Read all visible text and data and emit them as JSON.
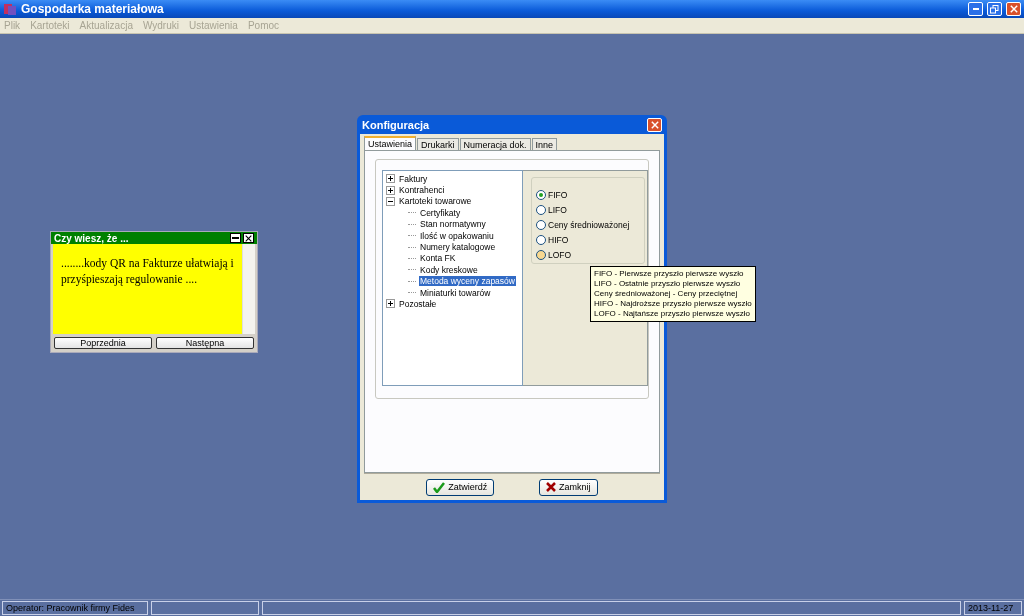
{
  "window": {
    "title": "Gospodarka materiałowa"
  },
  "menu": [
    {
      "label": "Plik",
      "disabled": true
    },
    {
      "label": "Kartoteki",
      "disabled": true
    },
    {
      "label": "Aktualizacja",
      "disabled": true
    },
    {
      "label": "Wydruki",
      "disabled": true
    },
    {
      "label": "Ustawienia",
      "disabled": true
    },
    {
      "label": "Pomoc",
      "disabled": true
    }
  ],
  "tip_window": {
    "title": "Czy wiesz, że ...",
    "message": "........kody QR na Fakturze ułatwiają i przyśpieszają regulowanie ....",
    "buttons": [
      "Poprzednia",
      "Następna"
    ]
  },
  "dialog": {
    "title": "Konfiguracja",
    "tabs": [
      {
        "label": "Ustawienia",
        "selected": true
      },
      {
        "label": "Drukarki",
        "selected": false
      },
      {
        "label": "Numeracja dok.",
        "selected": false
      },
      {
        "label": "Inne",
        "selected": false
      }
    ],
    "tree": [
      {
        "label": "Faktury",
        "expanded": false,
        "selected": false
      },
      {
        "label": "Kontrahenci",
        "expanded": false,
        "selected": false
      },
      {
        "label": "Kartoteki towarowe",
        "expanded": true,
        "selected": false,
        "children": [
          {
            "label": "Certyfikaty",
            "selected": false
          },
          {
            "label": "Stan normatywny",
            "selected": false
          },
          {
            "label": "Ilość w opakowaniu",
            "selected": false
          },
          {
            "label": "Numery katalogowe",
            "selected": false
          },
          {
            "label": "Konta FK",
            "selected": false
          },
          {
            "label": "Kody kreskowe",
            "selected": false
          },
          {
            "label": "Metoda wyceny zapasów",
            "selected": true
          },
          {
            "label": "Miniaturki towarów",
            "selected": false
          }
        ]
      },
      {
        "label": "Pozostałe",
        "expanded": false,
        "selected": false
      }
    ],
    "options": [
      {
        "label": "FIFO",
        "selected": true,
        "hovered": false
      },
      {
        "label": "LIFO",
        "selected": false,
        "hovered": false
      },
      {
        "label": "Ceny średnioważonej",
        "selected": false,
        "hovered": false
      },
      {
        "label": "HIFO",
        "selected": false,
        "hovered": false
      },
      {
        "label": "LOFO",
        "selected": false,
        "hovered": true
      }
    ],
    "tooltip": [
      "FIFO - Pierwsze przyszło pierwsze wyszło",
      "LIFO - Ostatnie przyszło pierwsze wyszło",
      "Ceny średnioważonej - Ceny przeciętnej",
      "HIFO - Najdroższe przyszło pierwsze wyszło",
      "LOFO - Najtańsze przyszło pierwsze wyszło"
    ],
    "buttons": [
      {
        "label": "Zatwierdź",
        "kind": "confirm"
      },
      {
        "label": "Zamknij",
        "kind": "close"
      }
    ]
  },
  "status_bar": {
    "operator": "Operator: Pracownik firmy Fides",
    "date": "2013-11-27"
  }
}
